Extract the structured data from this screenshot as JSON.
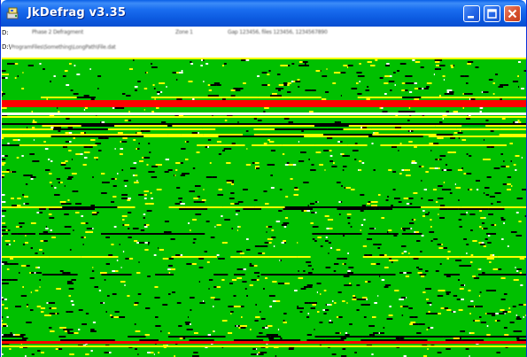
{
  "window": {
    "title": "JkDefrag v3.35",
    "icon": "jkdefrag-app-icon"
  },
  "status": {
    "line1_drive": "D:",
    "line1_seg_a": "Phase 2 Defragment",
    "line1_seg_b": "Zone 1",
    "line1_seg_c": "Gap 123456, files 123456, 1234567890",
    "line2_prefix": "D:\\",
    "line2_path": "ProgramFiles\\Something\\LongPath\\File.dat"
  },
  "colors": {
    "map_free": "#00c000",
    "map_fragmented": "#ff0000",
    "map_unmovable": "#ffff00",
    "map_spacehog": "#000000",
    "map_busy": "#ffffff",
    "titlebar": "#0a5fe6"
  }
}
